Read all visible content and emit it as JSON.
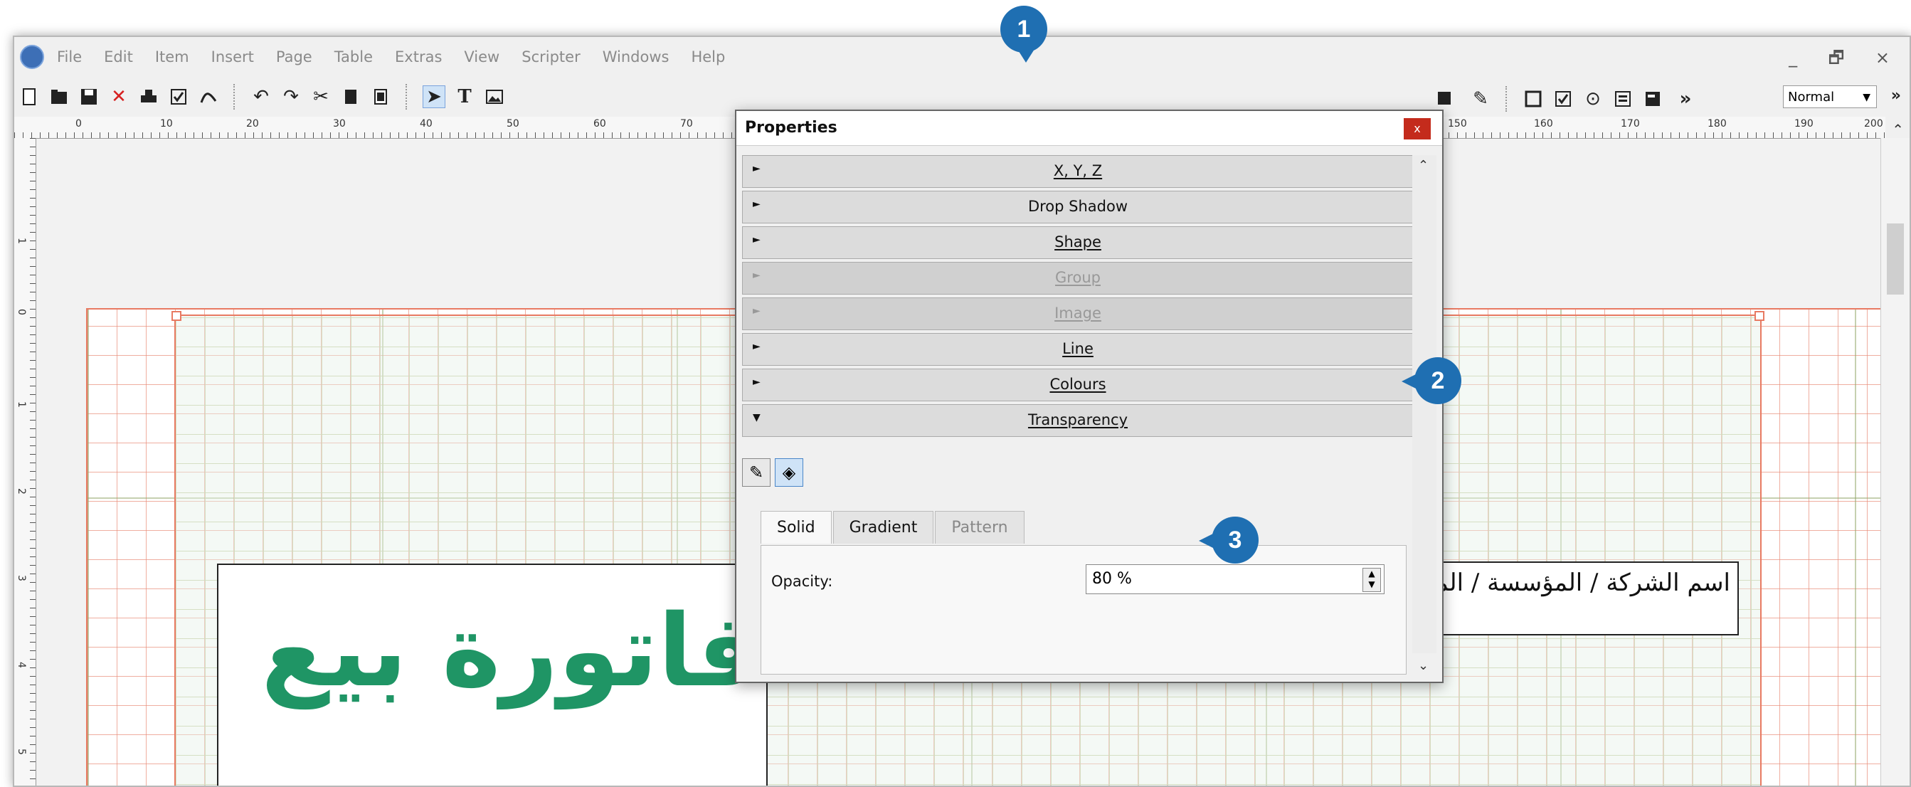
{
  "menu": {
    "items": [
      "File",
      "Edit",
      "Item",
      "Insert",
      "Page",
      "Table",
      "Extras",
      "View",
      "Scripter",
      "Windows",
      "Help"
    ]
  },
  "window_controls": "_ 🗗 ×",
  "toolbar": {
    "style_value": "Normal",
    "more_label": "»"
  },
  "rulers": {
    "h_ticks": [
      "0",
      "10",
      "20",
      "30",
      "40",
      "50",
      "60",
      "70",
      "150",
      "160",
      "170",
      "180",
      "190",
      "200"
    ],
    "v_ticks": [
      "1",
      "0",
      "1",
      "2",
      "3",
      "4",
      "5"
    ]
  },
  "dialog": {
    "title": "Properties",
    "close_label": "x",
    "sections": [
      {
        "label": "X, Y, Z",
        "expanded": false,
        "disabled": false
      },
      {
        "label": "Drop Shadow",
        "expanded": false,
        "disabled": false
      },
      {
        "label": "Shape",
        "expanded": false,
        "disabled": false
      },
      {
        "label": "Group",
        "expanded": false,
        "disabled": true
      },
      {
        "label": "Image",
        "expanded": false,
        "disabled": true
      },
      {
        "label": "Line",
        "expanded": false,
        "disabled": false
      },
      {
        "label": "Colours",
        "expanded": false,
        "disabled": false
      },
      {
        "label": "Transparency",
        "expanded": true,
        "disabled": false
      }
    ],
    "tabs": [
      "Solid",
      "Gradient",
      "Pattern"
    ],
    "active_tab": "Solid",
    "opacity_label": "Opacity:",
    "opacity_value": "80 %"
  },
  "document": {
    "invoice_title": "فاتورة بيع",
    "company_text": "اسم الشركة / المؤسسة / المتجر"
  },
  "callouts": [
    "1",
    "2",
    "3"
  ],
  "colors": {
    "accent_callout": "#1f6fb2",
    "invoice_title": "#1f9565",
    "close_button": "#c42b1c",
    "margin_guides": "#e87a62"
  }
}
